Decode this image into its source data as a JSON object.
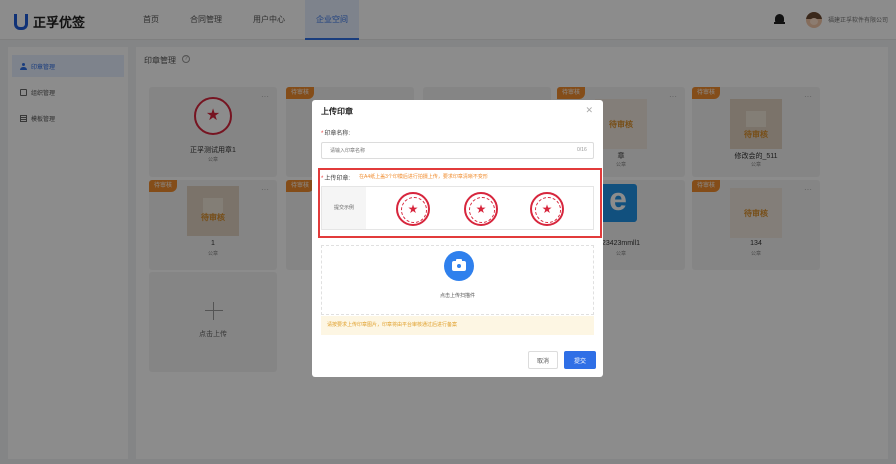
{
  "header": {
    "logo_text": "正孚优签",
    "nav": [
      {
        "label": "首页"
      },
      {
        "label": "合同管理"
      },
      {
        "label": "用户中心"
      },
      {
        "label": "企业空间"
      }
    ],
    "company": "福建正孚软件有限公司"
  },
  "sidebar": {
    "items": [
      {
        "label": "印章管理"
      },
      {
        "label": "组织管理"
      },
      {
        "label": "模板管理"
      }
    ]
  },
  "content": {
    "title": "印章管理",
    "cards": [
      {
        "name": "正孚测试用章1",
        "type": "公章"
      },
      {
        "badge": "待审核",
        "name": "章",
        "type": "公章",
        "watermark": "待审核"
      },
      {
        "badge": "待审核",
        "name": "修改会的_511",
        "type": "公章",
        "watermark": "待审核"
      },
      {
        "badge": "待审核",
        "name": "1",
        "type": "公章",
        "watermark": "待审核"
      },
      {
        "name": "23423mmll1",
        "type": "公章"
      },
      {
        "badge": "待审核",
        "name": "134",
        "type": "公章",
        "watermark": "待审核"
      }
    ],
    "hidden_badges": [
      "待审核",
      "待审核",
      "待审核"
    ],
    "add_label": "点击上传"
  },
  "modal": {
    "title": "上传印章",
    "name_label": "印章名称:",
    "name_placeholder": "请输入印章名称",
    "counter": "0/16",
    "upload_label": "上传印章:",
    "upload_hint": "在A4纸上盖3个印模后进行拍摄上传，要求印章清晰不变形",
    "example_label": "提交示例",
    "dropzone_label": "点击上传扫描件",
    "warning": "请按要求上传印章图片，印章将由平台审核通过后进行备案",
    "cancel": "取消",
    "submit": "提交"
  }
}
